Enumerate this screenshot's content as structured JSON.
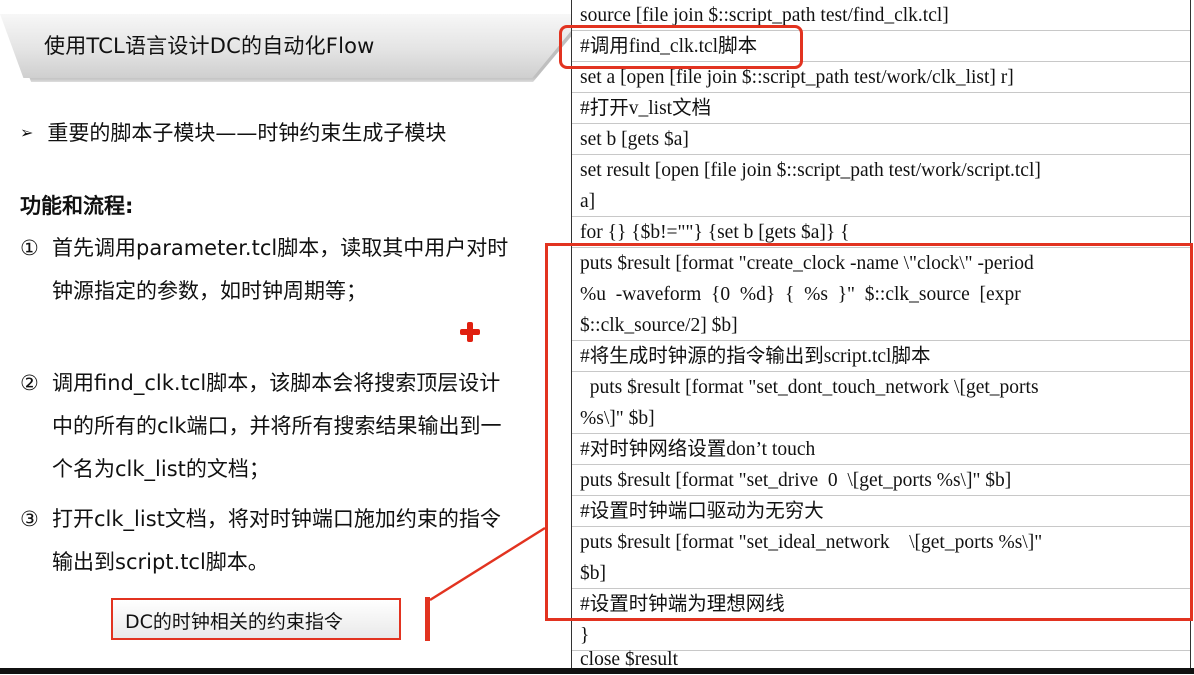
{
  "slide": {
    "title": "使用TCL语言设计DC的自动化Flow",
    "bullet": "重要的脚本子模块——时钟约束生成子模块",
    "heading": "功能和流程:",
    "steps": [
      {
        "num": "①",
        "text": "首先调用parameter.tcl脚本，读取其中用户对时钟源指定的参数，如时钟周期等；"
      },
      {
        "num": "②",
        "text": "调用find_clk.tcl脚本，该脚本会将搜索顶层设计中的所有的clk端口，并将所有搜索结果输出到一个名为clk_list的文档；"
      },
      {
        "num": "③",
        "text": "打开clk_list文档，将对时钟端口施加约束的指令输出到script.tcl脚本。"
      }
    ],
    "note": "DC的时钟相关的约束指令",
    "accent_color": "#e23320"
  },
  "code": {
    "lines": [
      "source [file join $::script_path test/find_clk.tcl]",
      "#调用find_clk.tcl脚本",
      "set a [open [file join $::script_path test/work/clk_list] r]",
      "#打开v_list文档",
      "set b [gets $a]",
      "set result [open [file join $::script_path test/work/script.tcl]",
      "a]",
      "for {} {$b!=\"\"} {set b [gets $a]} {",
      "puts $result [format \"create_clock -name \\\"clock\\\" -period",
      "%u  -waveform  {0  %d}  {  %s  }\"  $::clk_source  [expr",
      "$::clk_source/2] $b]",
      "#将生成时钟源的指令输出到script.tcl脚本",
      "  puts $result [format \"set_dont_touch_network \\[get_ports",
      "%s\\]\" $b]",
      "#对时钟网络设置don’t touch",
      "puts $result [format \"set_drive  0  \\[get_ports %s\\]\" $b]",
      "#设置时钟端口驱动为无穷大",
      "puts $result [format \"set_ideal_network    \\[get_ports %s\\]\"",
      "$b]",
      "#设置时钟端为理想网线",
      "}",
      "close $result"
    ]
  }
}
